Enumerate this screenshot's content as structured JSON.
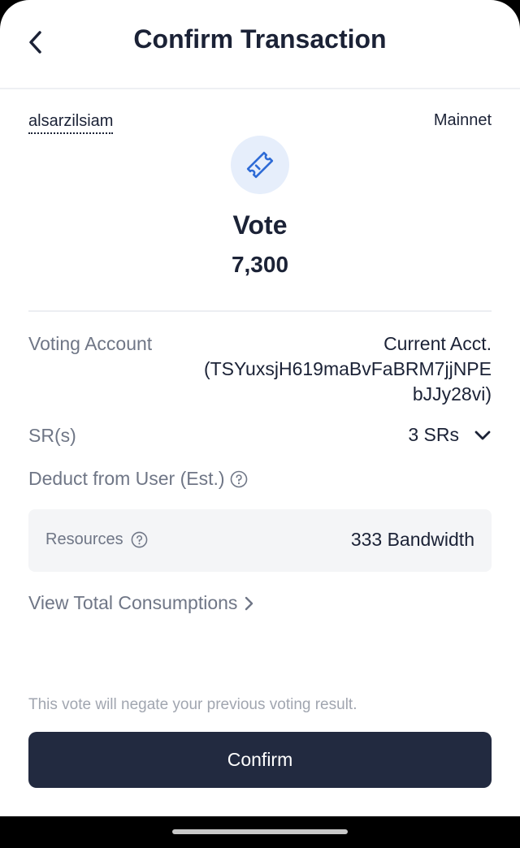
{
  "header": {
    "title": "Confirm Transaction"
  },
  "account": {
    "name": "alsarzilsiam",
    "network": "Mainnet"
  },
  "transaction": {
    "type": "Vote",
    "amount": "7,300"
  },
  "details": {
    "voting_account_label": "Voting Account",
    "voting_account_lines": [
      "Current Acct.",
      "(TSYuxsjH619maBvFaBRM7jjNPE",
      "bJJy28vi)"
    ],
    "srs_label": "SR(s)",
    "srs_value": "3 SRs",
    "deduct_label": "Deduct from User (Est.)"
  },
  "resources": {
    "label": "Resources",
    "value": "333 Bandwidth"
  },
  "links": {
    "view_total": "View Total Consumptions"
  },
  "notice": "This vote will negate your previous voting result.",
  "actions": {
    "confirm_label": "Confirm"
  },
  "icons": {
    "back": "chevron-left-icon",
    "transaction": "ticket-icon",
    "dropdown": "chevron-down-icon",
    "help": "question-circle-icon",
    "link_arrow": "chevron-right-icon"
  },
  "colors": {
    "primary": "#222a40",
    "text": "#1b2236",
    "muted": "#6f7686",
    "icon_bg": "#e6eefb",
    "icon_fg": "#2e6bd6"
  }
}
